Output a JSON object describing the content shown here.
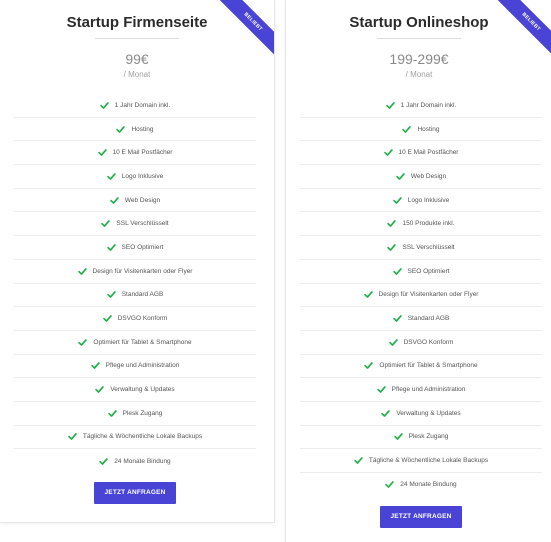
{
  "plans": [
    {
      "badge": "BELIEBT",
      "title": "Startup Firmenseite",
      "price": "99€",
      "period": "/ Monat",
      "features": [
        "1 Jahr Domain inkl.",
        "Hosting",
        "10 E Mail Postfächer",
        "Logo Inklusive",
        "Web Design",
        "SSL Verschlüsselt",
        "SEO Optimiert",
        "Design für Visitenkarten oder Flyer",
        "Standard AGB",
        "DSVGO Konform",
        "Optimiert für Tablet & Smartphone",
        "Pflege und Administration",
        "Verwaltung & Updates",
        "Plesk Zugang",
        "Tägliche & Wöchentliche Lokale Backups",
        "24 Monate Bindung"
      ],
      "button_label": "JETZT ANFRAGEN"
    },
    {
      "badge": "BELIEBT",
      "title": "Startup Onlineshop",
      "price": "199-299€",
      "period": "/ Monat",
      "features": [
        "1 Jahr Domain inkl.",
        "Hosting",
        "10 E Mail Postfächer",
        "Web Design",
        "Logo Inklusive",
        "150 Produkte inkl.",
        "SSL Verschlüsselt",
        "SEO Optimiert",
        "Design für Visitenkarten oder Flyer",
        "Standard AGB",
        "DSVGO Konform",
        "Optimiert für Tablet & Smartphone",
        "Pflege und Administration",
        "Verwaltung & Updates",
        "Plesk Zugang",
        "Tägliche & Wöchentliche Lokale Backups",
        "24 Monate Bindung"
      ],
      "button_label": "JETZT ANFRAGEN"
    }
  ],
  "colors": {
    "accent": "#4a44d6",
    "check": "#22b04b"
  },
  "icons": {
    "feature": "check-icon"
  }
}
